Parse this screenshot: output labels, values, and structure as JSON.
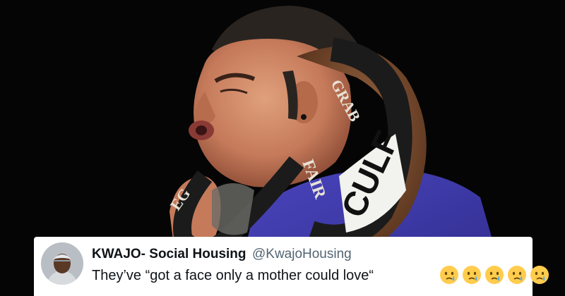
{
  "tweet": {
    "display_name": "KWAJO- Social Housing",
    "handle": "@KwajoHousing",
    "text": "They’ve “got a face only a mother could love“",
    "emojis": [
      "crying-face-emoji",
      "crying-face-emoji",
      "crying-face-emoji",
      "crying-face-emoji",
      "crying-face-emoji"
    ]
  },
  "photo": {
    "collar_text_top": "GRAB",
    "collar_text_middle": "FAIR",
    "collar_text_big": "CULF",
    "collar_text_left": "EG"
  },
  "colors": {
    "background": "#050505",
    "shirt": "#3e3aa8",
    "collar_brown": "#7a4a2a",
    "collar_black": "#1b1b1b",
    "skin": "#c57a5a",
    "card": "#ffffff",
    "name": "#0f1419",
    "handle": "#536471"
  }
}
